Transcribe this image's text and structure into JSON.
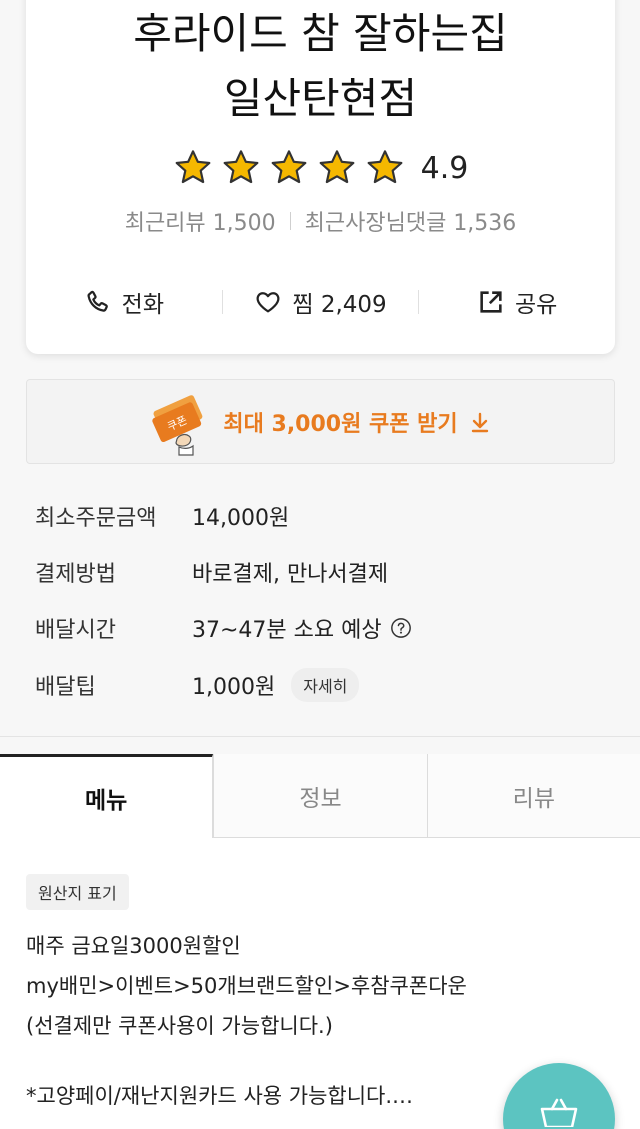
{
  "store": {
    "name_line1": "후라이드 참 잘하는집",
    "name_line2": "일산탄현점",
    "rating": "4.9",
    "stars": 5,
    "recent_reviews": "최근리뷰 1,500",
    "recent_owner_replies": "최근사장님댓글 1,536"
  },
  "actions": {
    "call_label": "전화",
    "wish_label": "찜 2,409",
    "share_label": "공유"
  },
  "coupon": {
    "label": "최대 3,000원 쿠폰 받기",
    "badge_text": "쿠폰"
  },
  "info": [
    {
      "label": "최소주문금액",
      "value": "14,000원"
    },
    {
      "label": "결제방법",
      "value": "바로결제, 만나서결제"
    },
    {
      "label": "배달시간",
      "value": "37~47분 소요 예상"
    },
    {
      "label": "배달팁",
      "value": "1,000원"
    }
  ],
  "delivery_tip_detail": "자세히",
  "tabs": [
    {
      "label": "메뉴",
      "active": true
    },
    {
      "label": "정보",
      "active": false
    },
    {
      "label": "리뷰",
      "active": false
    }
  ],
  "menu_content": {
    "origin_chip": "원산지 표기",
    "notice_lines": [
      "매주 금요일3000원할인",
      "my배민>이벤트>50개브랜드할인>후참쿠폰다운",
      "(선결제만 쿠폰사용이 가능합니다.)",
      "",
      "*고양페이/재난지원카드 사용 가능합니다.…"
    ]
  },
  "colors": {
    "accent_orange": "#e87b1f",
    "star_yellow": "#f5b800",
    "fab_teal": "#5cc4c1"
  },
  "icons": {
    "call": "phone-icon",
    "wish": "heart-icon",
    "share": "share-icon",
    "coupon_arrow": "download-arrow-icon",
    "help": "help-circle-icon",
    "cart": "shopping-basket-icon"
  }
}
